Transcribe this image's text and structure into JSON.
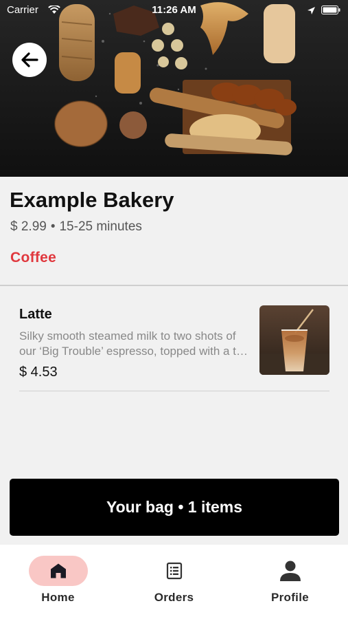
{
  "status_bar": {
    "carrier": "Carrier",
    "time": "11:26 AM"
  },
  "store": {
    "name": "Example Bakery",
    "delivery_fee": "$ 2.99",
    "separator": "•",
    "delivery_time": "15-25 minutes"
  },
  "menu": {
    "category": "Coffee",
    "items": [
      {
        "name": "Latte",
        "description": "Silky smooth steamed milk to two shots of our ‘Big Trouble’ espresso, topped with a thin layer of foam.",
        "price": "$ 4.53"
      }
    ]
  },
  "bag": {
    "label": "Your bag • 1 items"
  },
  "nav": {
    "tabs": [
      {
        "label": "Home",
        "icon": "home-icon",
        "active": true
      },
      {
        "label": "Orders",
        "icon": "receipt-list-icon",
        "active": false
      },
      {
        "label": "Profile",
        "icon": "person-icon",
        "active": false
      }
    ]
  },
  "colors": {
    "accent_red": "#e0383e",
    "active_tab_bg": "#f9c7c5",
    "background": "#f1f1f1",
    "button_black": "#000000"
  }
}
